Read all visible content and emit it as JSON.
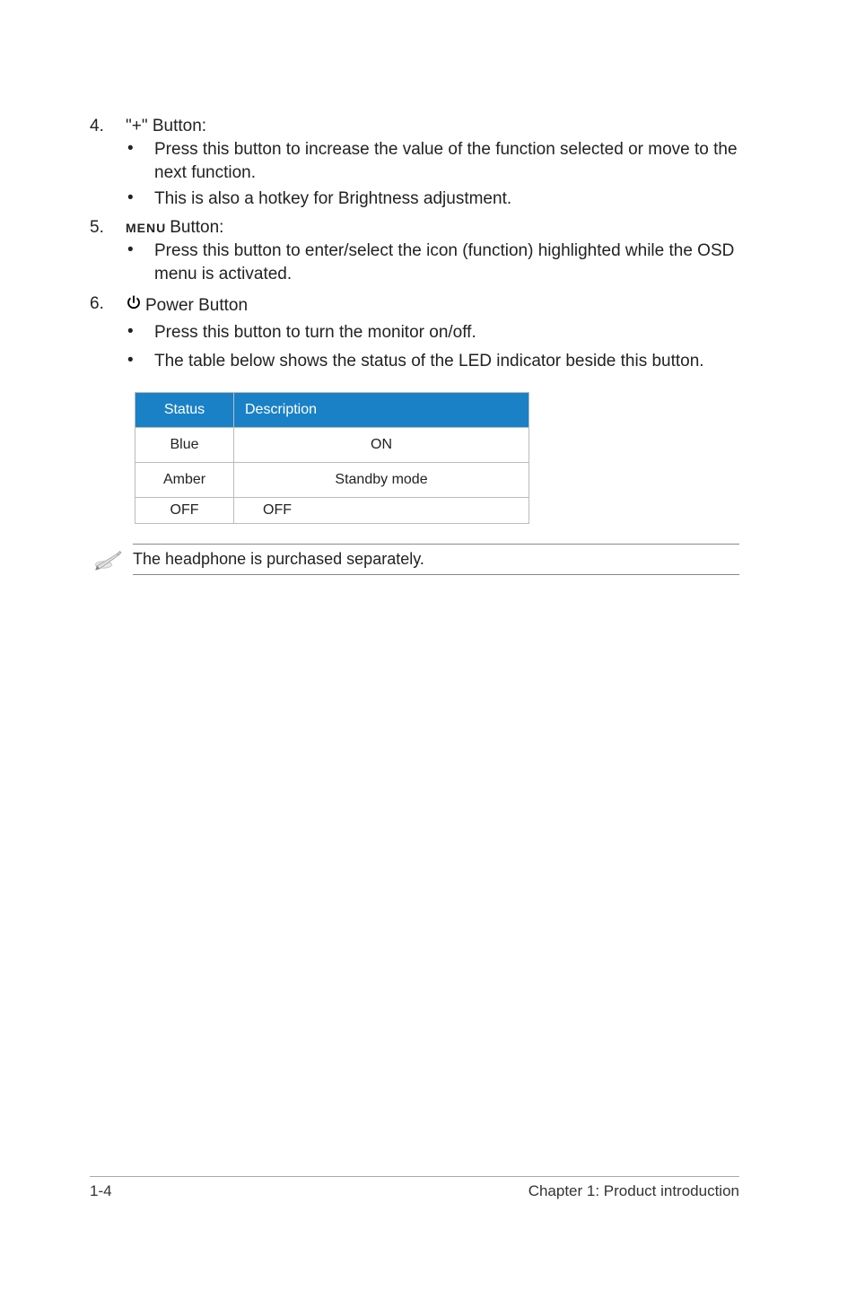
{
  "items": [
    {
      "num": "4.",
      "title": "\"+\" Button:",
      "bullets": [
        "Press this button to increase the value of the function selected or move to the next function.",
        "This is also a hotkey for Brightness adjustment."
      ]
    },
    {
      "num": "5.",
      "menu_label": "MENU",
      "title": "Button:",
      "bullets": [
        "Press this button to enter/select the icon (function) highlighted while the OSD menu is activated."
      ]
    },
    {
      "num": "6.",
      "has_power_icon": true,
      "title": "Power Button",
      "bullets": [
        "Press this button to turn the monitor on/off.",
        "The table below shows the status of the LED indicator beside this button."
      ]
    }
  ],
  "table": {
    "headers": [
      "Status",
      "Description"
    ],
    "rows": [
      [
        "Blue",
        "ON"
      ],
      [
        "Amber",
        "Standby mode"
      ],
      [
        "OFF",
        "OFF"
      ]
    ]
  },
  "note": "The headphone is purchased separately.",
  "footer": {
    "left": "1-4",
    "right": "Chapter 1: Product introduction"
  }
}
